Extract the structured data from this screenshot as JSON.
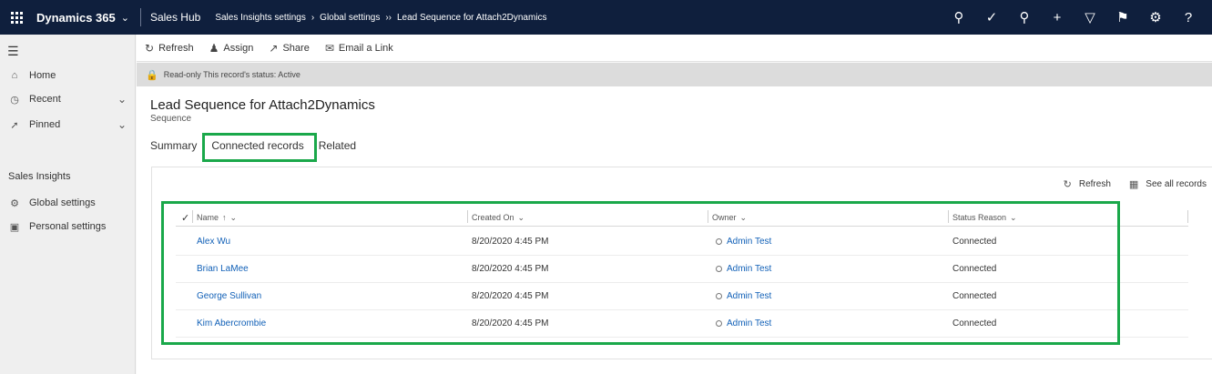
{
  "topbar": {
    "app_name": "Dynamics 365",
    "module": "Sales Hub",
    "breadcrumbs": [
      "Sales Insights settings",
      "Global settings",
      "Lead Sequence for Attach2Dynamics"
    ],
    "icons": [
      "search-icon",
      "task-icon",
      "lightbulb-icon",
      "plus-icon",
      "filter-icon",
      "assistant-icon",
      "gear-icon",
      "help-icon"
    ]
  },
  "leftnav": {
    "items": [
      {
        "label": "Home",
        "icon": "home-icon"
      },
      {
        "label": "Recent",
        "icon": "clock-icon"
      },
      {
        "label": "Pinned",
        "icon": "pin-icon"
      }
    ],
    "section_title": "Sales Insights",
    "section_items": [
      {
        "label": "Global settings",
        "icon": "settings-group-icon"
      },
      {
        "label": "Personal settings",
        "icon": "cube-icon"
      }
    ]
  },
  "commandbar": {
    "refresh": "Refresh",
    "assign": "Assign",
    "share": "Share",
    "email_link": "Email a Link"
  },
  "status": {
    "text": "Read-only This record's status: Active"
  },
  "record": {
    "title": "Lead Sequence for Attach2Dynamics",
    "entity": "Sequence"
  },
  "tabs": {
    "summary": "Summary",
    "connected": "Connected records",
    "related": "Related"
  },
  "grid": {
    "refresh": "Refresh",
    "see_all": "See all records",
    "columns": {
      "name": "Name",
      "created_on": "Created On",
      "owner": "Owner",
      "status_reason": "Status Reason"
    },
    "rows": [
      {
        "name": "Alex Wu",
        "created_on": "8/20/2020 4:45 PM",
        "owner": "Admin Test",
        "status": "Connected"
      },
      {
        "name": "Brian LaMee",
        "created_on": "8/20/2020 4:45 PM",
        "owner": "Admin Test",
        "status": "Connected"
      },
      {
        "name": "George Sullivan",
        "created_on": "8/20/2020 4:45 PM",
        "owner": "Admin Test",
        "status": "Connected"
      },
      {
        "name": "Kim Abercrombie",
        "created_on": "8/20/2020 4:45 PM",
        "owner": "Admin Test",
        "status": "Connected"
      }
    ]
  },
  "colors": {
    "topbar": "#0f1f3d",
    "highlight": "#1aa84a",
    "link": "#1160b7",
    "tab_underline": "#2266e3"
  }
}
